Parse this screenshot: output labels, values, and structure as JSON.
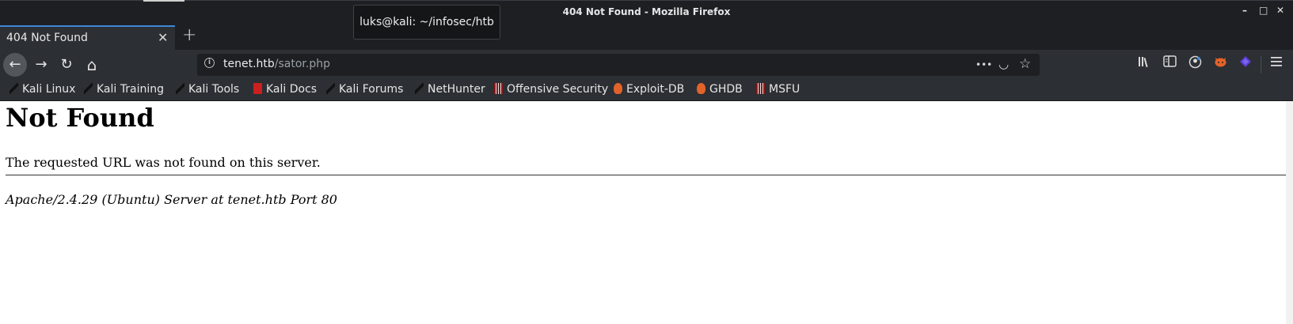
{
  "window": {
    "title": "404 Not Found - Mozilla Firefox",
    "controls": [
      "–",
      "□",
      "✕"
    ]
  },
  "tooltip": {
    "text": "luks@kali: ~/infosec/htb"
  },
  "tabs": [
    {
      "title": "404 Not Found",
      "close": "✕"
    }
  ],
  "newtab_label": "+",
  "nav": {
    "back": "←",
    "forward": "→",
    "reload": "↻",
    "home": "⌂"
  },
  "url": {
    "host": "tenet.htb",
    "path": "/sator.php",
    "info_icon": "i",
    "more": "•••",
    "pocket": "◡",
    "star": "☆"
  },
  "toolbar_icons": [
    "library-icon",
    "sidebar-icon",
    "account-icon",
    "extension-fox-icon",
    "extension-purple-icon",
    "menu-icon"
  ],
  "bookmarks": [
    {
      "label": "Kali Linux",
      "icon": "kali-dragon-icon"
    },
    {
      "label": "Kali Training",
      "icon": "kali-dragon-icon"
    },
    {
      "label": "Kali Tools",
      "icon": "kali-dragon-icon"
    },
    {
      "label": "Kali Docs",
      "icon": "kali-docs-icon"
    },
    {
      "label": "Kali Forums",
      "icon": "kali-dragon-icon"
    },
    {
      "label": "NetHunter",
      "icon": "kali-dragon-icon"
    },
    {
      "label": "Offensive Security",
      "icon": "offsec-icon"
    },
    {
      "label": "Exploit-DB",
      "icon": "exploitdb-icon"
    },
    {
      "label": "GHDB",
      "icon": "exploitdb-icon"
    },
    {
      "label": "MSFU",
      "icon": "offsec-icon"
    }
  ],
  "page": {
    "heading": "Not Found",
    "message": "The requested URL was not found on this server.",
    "address": "Apache/2.4.29 (Ubuntu) Server at tenet.htb Port 80"
  },
  "colors": {
    "chrome_dark": "#1d1f23",
    "toolbar": "#2c2f34",
    "tab_accent": "#3f88d5"
  }
}
